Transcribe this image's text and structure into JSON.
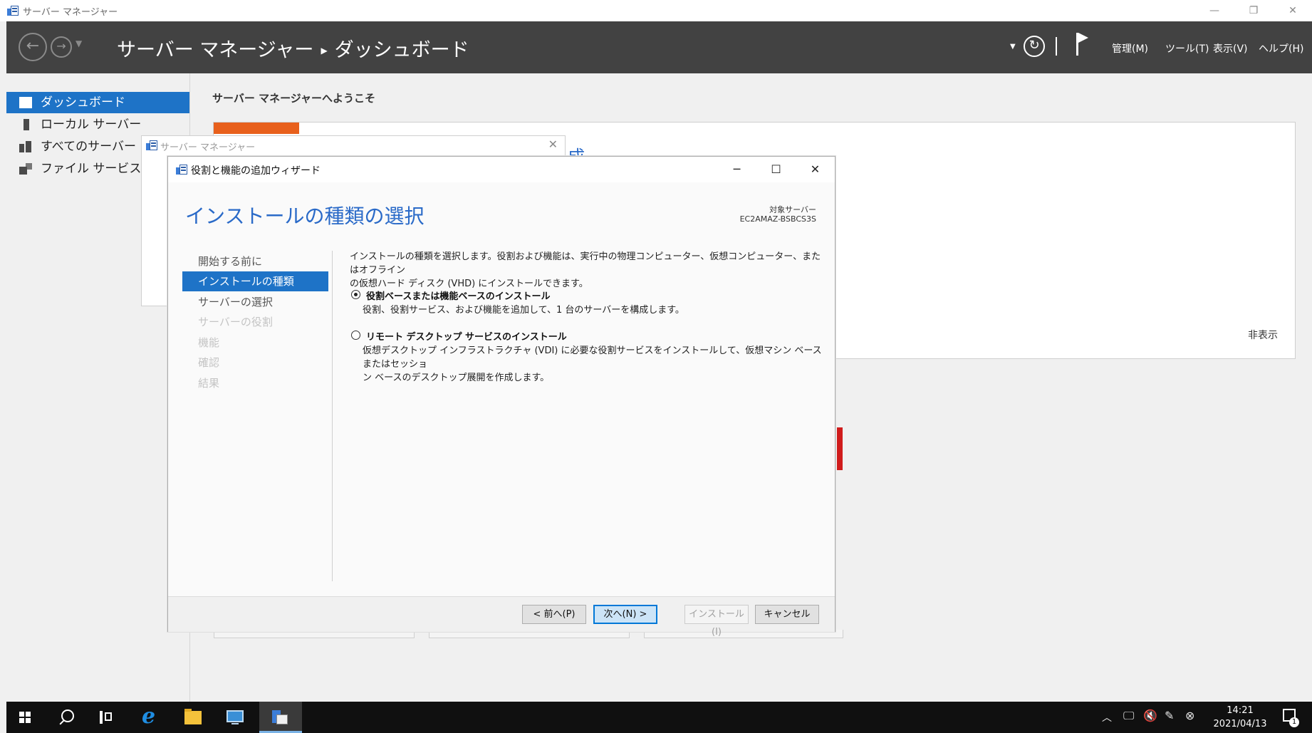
{
  "window": {
    "title": "サーバー マネージャー",
    "controls": {
      "minimize": "—",
      "restore": "❐",
      "close": "✕"
    }
  },
  "header": {
    "title_part1": "サーバー マネージャー",
    "separator": "▶",
    "title_part2": "ダッシュボード",
    "menu": [
      "管理(M)",
      "ツール(T)",
      "表示(V)",
      "ヘルプ(H)"
    ]
  },
  "sidebar": {
    "items": [
      {
        "label": "ダッシュボード",
        "icon": "dashboard-icon",
        "active": true
      },
      {
        "label": "ローカル サーバー",
        "icon": "server-icon"
      },
      {
        "label": "すべてのサーバー",
        "icon": "servers-icon"
      },
      {
        "label": "ファイル サービスと記憶",
        "icon": "file-storage-icon"
      }
    ]
  },
  "dashboard": {
    "welcome": "サーバー マネージャーへようこそ",
    "hide": "非表示",
    "behind_text": "成"
  },
  "background_dialog": {
    "title": "サーバー マネージャー",
    "close": "✕"
  },
  "wizard": {
    "title": "役割と機能の追加ウィザード",
    "controls": {
      "minimize": "─",
      "maximize": "☐",
      "close": "✕"
    },
    "heading": "インストールの種類の選択",
    "target_label": "対象サーバー",
    "target_value": "EC2AMAZ-BSBCS3S",
    "steps": [
      {
        "label": "開始する前に",
        "state": "enabled"
      },
      {
        "label": "インストールの種類",
        "state": "active"
      },
      {
        "label": "サーバーの選択",
        "state": "enabled"
      },
      {
        "label": "サーバーの役割",
        "state": "disabled"
      },
      {
        "label": "機能",
        "state": "disabled"
      },
      {
        "label": "確認",
        "state": "disabled"
      },
      {
        "label": "結果",
        "state": "disabled"
      }
    ],
    "description_line1": "インストールの種類を選択します。役割および機能は、実行中の物理コンピューター、仮想コンピューター、またはオフライン",
    "description_line2": "の仮想ハード ディスク (VHD) にインストールできます。",
    "options": [
      {
        "title": "役割ベースまたは機能ベースのインストール",
        "desc_line1": "役割、役割サービス、および機能を追加して、1 台のサーバーを構成します。",
        "desc_line2": "",
        "selected": true
      },
      {
        "title": "リモート デスクトップ サービスのインストール",
        "desc_line1": "仮想デスクトップ インフラストラクチャ (VDI) に必要な役割サービスをインストールして、仮想マシン ベースまたはセッショ",
        "desc_line2": "ン ベースのデスクトップ展開を作成します。",
        "selected": false
      }
    ],
    "buttons": {
      "previous": "< 前へ(P)",
      "next": "次へ(N) >",
      "install": "インストール(I)",
      "cancel": "キャンセル"
    }
  },
  "taskbar": {
    "time": "14:21",
    "date": "2021/04/13",
    "notification_count": "1"
  },
  "colors": {
    "accent": "#1e73c7",
    "header_bg": "#424242",
    "heading": "#2a6ac8",
    "tile_orange": "#e8601c",
    "alert_red": "#d01c1c"
  }
}
